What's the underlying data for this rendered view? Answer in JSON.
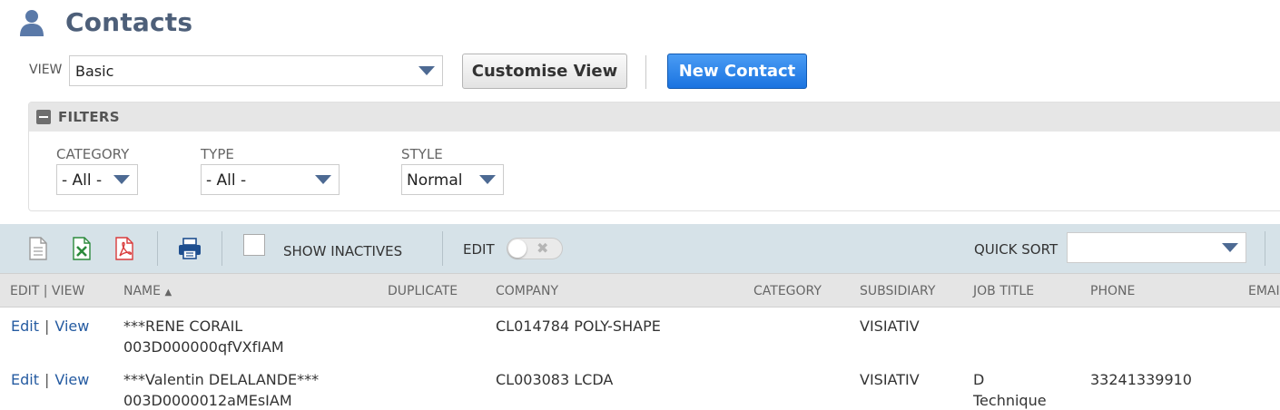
{
  "header": {
    "title": "Contacts",
    "icon": "person-icon"
  },
  "view": {
    "label": "VIEW",
    "selected": "Basic",
    "customise_label": "Customise View",
    "new_label": "New Contact"
  },
  "filters": {
    "title": "FILTERS",
    "category": {
      "label": "CATEGORY",
      "value": "- All -"
    },
    "type": {
      "label": "TYPE",
      "value": "- All -"
    },
    "style": {
      "label": "STYLE",
      "value": "Normal"
    }
  },
  "toolbar": {
    "show_inactives_label": "SHOW INACTIVES",
    "edit_label": "EDIT",
    "quick_sort_label": "QUICK SORT",
    "quick_sort_value": ""
  },
  "table": {
    "columns": {
      "edit_view": "EDIT | VIEW",
      "name": "NAME",
      "duplicate": "DUPLICATE",
      "company": "COMPANY",
      "category": "CATEGORY",
      "subsidiary": "SUBSIDIARY",
      "job_title": "JOB TITLE",
      "phone": "PHONE",
      "email": "EMAIL"
    },
    "sort_indicator": "▲",
    "edit_link": "Edit",
    "view_link": "View",
    "separator": "|",
    "rows": [
      {
        "name": "***RENE CORAIL",
        "id": "003D000000qfVXfIAM",
        "duplicate": "",
        "company": "CL014784 POLY-SHAPE",
        "category": "",
        "subsidiary": "VISIATIV",
        "job_title_1": "",
        "job_title_2": "",
        "phone": ""
      },
      {
        "name": "***Valentin DELALANDE***",
        "id": "003D0000012aMEsIAM",
        "duplicate": "",
        "company": "CL003083 LCDA",
        "category": "",
        "subsidiary": "VISIATIV",
        "job_title_1": "D",
        "job_title_2": "Technique",
        "phone": "33241339910"
      }
    ]
  },
  "colors": {
    "title": "#4d5f79",
    "accent": "#1a73e0",
    "link": "#255ba1",
    "toolbar_bg": "#d6e2e8"
  }
}
